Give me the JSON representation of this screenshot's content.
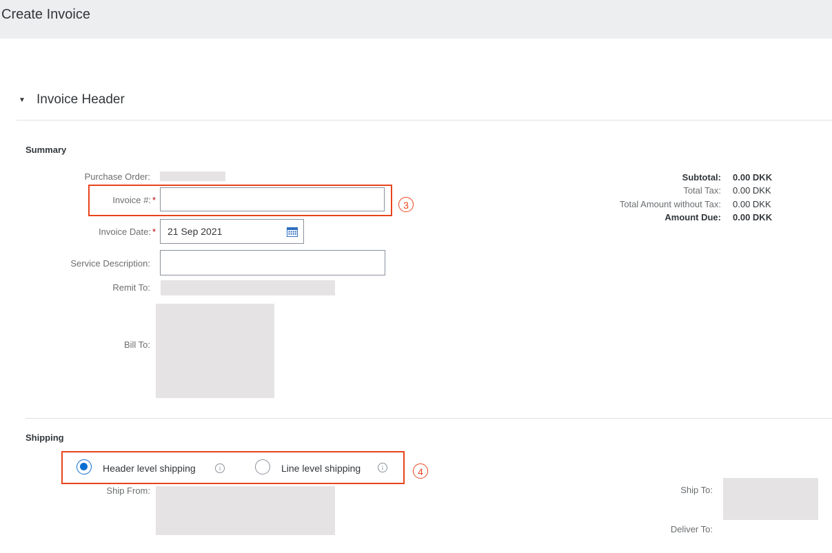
{
  "page": {
    "title": "Create Invoice"
  },
  "section": {
    "title": "Invoice Header",
    "toggle_icon": "▼"
  },
  "summary": {
    "title": "Summary",
    "purchase_order_label": "Purchase Order:",
    "invoice_no_label": "Invoice #:",
    "invoice_no_value": "",
    "invoice_date_label": "Invoice Date:",
    "invoice_date_value": "21 Sep 2021",
    "service_description_label": "Service Description:",
    "service_description_value": "",
    "remit_to_label": "Remit To:",
    "bill_to_label": "Bill To:",
    "required_marker": "*"
  },
  "totals": {
    "subtotal_label": "Subtotal:",
    "subtotal_value": "0.00 DKK",
    "total_tax_label": "Total Tax:",
    "total_tax_value": "0.00 DKK",
    "total_without_tax_label": "Total Amount without Tax:",
    "total_without_tax_value": "0.00 DKK",
    "amount_due_label": "Amount Due:",
    "amount_due_value": "0.00 DKK"
  },
  "shipping": {
    "title": "Shipping",
    "options": [
      {
        "label": "Header level shipping",
        "selected": true
      },
      {
        "label": "Line level shipping",
        "selected": false
      }
    ],
    "ship_from_label": "Ship From:",
    "ship_to_label": "Ship To:",
    "deliver_to_label": "Deliver To:",
    "info_glyph": "i"
  },
  "annotations": {
    "step3": "3",
    "step4": "4",
    "color": "#e8431a"
  },
  "colors": {
    "accent": "#0a6ed1",
    "required": "#bb0000",
    "redacted": "#e5e3e3"
  }
}
